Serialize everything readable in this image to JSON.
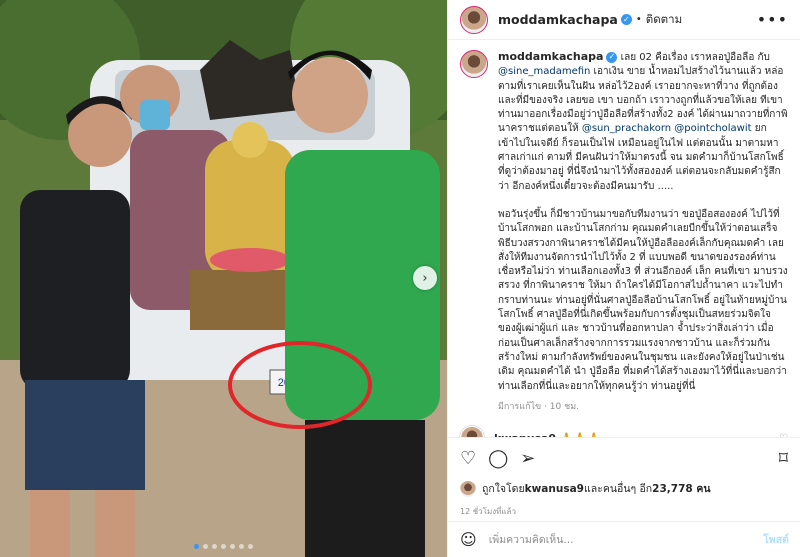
{
  "post": {
    "username": "moddamkachapa",
    "follow_label": "ติดตาม",
    "more": "•••"
  },
  "caption": {
    "username": "moddamkachapa",
    "p1_a": "เลย 02 คือเรื่อง เราหลอปู่อือลือ กับ ",
    "mention1": "@sine_madamefin",
    "p1_b": " เอาเงิน ขาย น้ำหอมไปสร้างไว้นานแล้ว หล่อตามที่เราเคยเห็นในฝัน หล่อไว้2องค์ เราอยากจะหาที่วาง ที่ถูกต้อง และที่มีของจริง เลยขอ เขา บอกถ้า เราวางถูกที่แล้วขอให้เลย ทีเขา ท่านมาออกเรื่องมือยู่ว่าปู่อือลือที่สร้างทั้ง2 องค์ ได้ผ่านมาถวายที่กาพินาคราชแต่ตอนให้ ",
    "mention2": "@sun_prachakorn",
    "mention3": "@pointcholawit",
    "p1_c": " ยกเข้าไปในเจดีย์ ก็รอนเป็นไฟ เหมือนอยู่ในไฟ แต่ตอนนั้น มาตามหา ศาลเก่าแก่ ตามที่ มีคนฝันว่าให้มาตรงนี้ จน มดคำมาก็บ้านโสกโพธิ์ที่ดูว่าต้องมาอยู่ ที่นี่จึงนำมาไว้ทั้งสององค์ แต่ตอนจะกลับมดคำรู้สึกว่า อีกองค์หนึ่งเดี๋ยวจะต้องมีคนมารับ .....",
    "p2": "พอวันรุ่งขึ้น ก็มีชาวบ้านมาขอกับทีมงานว่า ขอปู่อือสององค์ ไปไว้ที่บ้านโสกพอก และบ้านโสกก่าม คุณมดคำเลยบีกขึ้นให้ว่าตอนเสร็จพิธีบวงสรวงกาพินาคราชได้มีคนให้ปู่อือลือองค์เล็กกับคุณมดคำ เลยสั่งให้ทีมงานจัดการนำไปไว้ทั้ง 2 ที่ แบบพอดี ขนาดของรองค์ท่าน เชื่อหรือไม่ว่า ท่านเลือกเองทั้ง3 ที่ ส่วนอีกองค์ เล็ก คนที่เขา มาบรวงสรวง ที่กาพินาคราช ให้มา ถ้าใครได้มีโอกาสไปถ้ำนาคา แวะไปทำกราบท่านนะ ท่านอยู่ที่นั่นศาลปู่อือลือบ้านโสกโพธิ์ อยู่ในท้ายหมู่บ้านโสกโพธิ์ ศาลปู่อือที่นี่เกิดขึ้นพร้อมกับการตั้งชุมเป็นสหยร่วมจิตใจของผู้เฒ่าผู้แก่ และ ชาวบ้านที่ออกหาปลา จ้ำประว่าสิ่งเล่าว่า เมื่อก่อนเป็นศาลเล็กสร้างจากการรวมแรงจากชาวบ้าน และก็ร่วมกันสร้างใหม่ ตามกำลังทรัพย์ของคนในชุมชน และยังคงให้อยู่ในป่าเช่นเดิม คุณมดคำได้ นำ ปู่อือลือ ที่มดคำได้สร้างเองมาไว้ที่นี่และบอกว่า ท่านเลือกที่นี่และอยากให้ทุกคนรู้ว่า ท่านอยู่ที่นี่",
    "meta": "มีการแก้ไข · 10 ชม."
  },
  "comment": {
    "username": "kwanusa9",
    "text": "🙏🙏🙏"
  },
  "likes": {
    "prefix": "ถูกใจโดย ",
    "user": "kwanusa9",
    "middle": " และคนอื่นๆ อีก ",
    "count": "23,778 คน"
  },
  "date": "12 ชั่วโมงที่แล้ว",
  "add_comment": {
    "placeholder": "เพิ่มความคิดเห็น...",
    "post": "โพสต์"
  },
  "photo": {
    "plate": "2020"
  },
  "colors": {
    "verified": "#3897f0",
    "mention": "#00376b",
    "shirt_green": "#2fa84f",
    "circle_red": "#e0262b"
  }
}
